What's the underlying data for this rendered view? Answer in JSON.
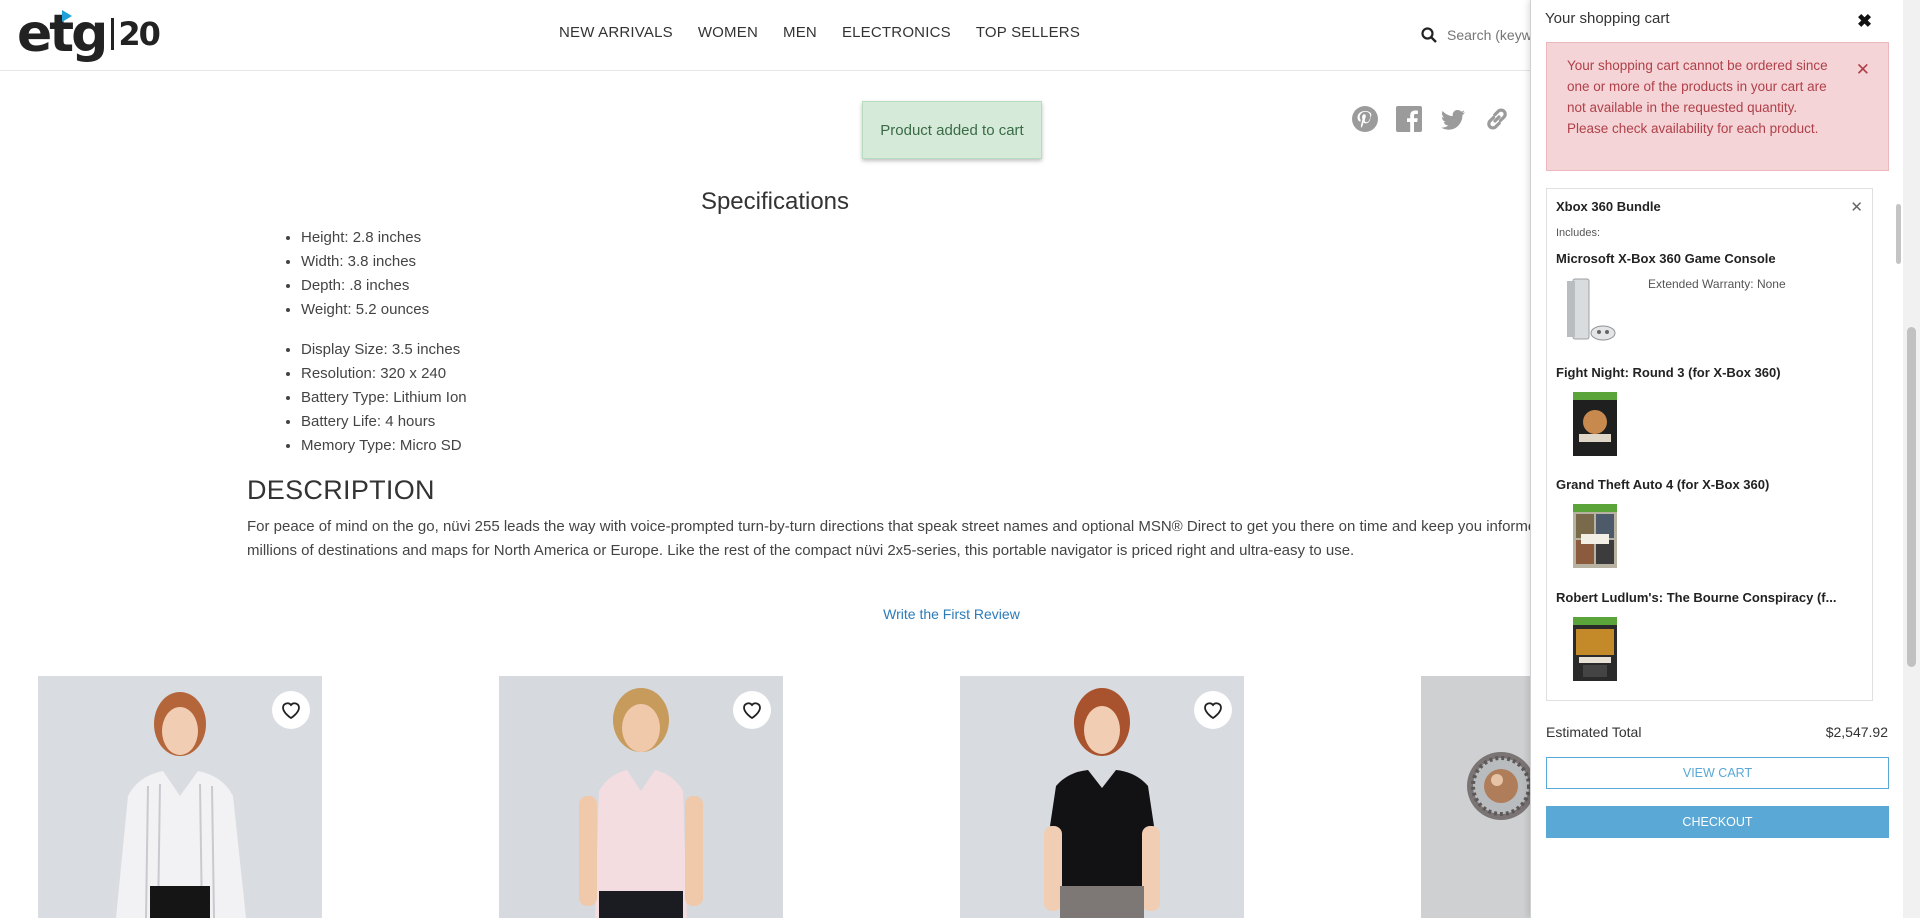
{
  "header": {
    "logo_main": "etg",
    "logo_badge": "20",
    "nav": [
      "NEW ARRIVALS",
      "WOMEN",
      "MEN",
      "ELECTRONICS",
      "TOP SELLERS"
    ],
    "search_placeholder": "Search (keywords, etc)"
  },
  "toast": "Product added to cart",
  "share_icons": [
    "pinterest-icon",
    "facebook-icon",
    "twitter-icon",
    "link-icon"
  ],
  "specs": {
    "title": "Specifications",
    "group_a": [
      "Height: 2.8 inches",
      "Width: 3.8 inches",
      "Depth: .8 inches",
      "Weight: 5.2 ounces"
    ],
    "group_b": [
      "Display Size: 3.5 inches",
      "Resolution: 320 x 240",
      "Battery Type: Lithium Ion",
      "Battery Life: 4 hours",
      "Memory Type: Micro SD"
    ]
  },
  "description": {
    "title": "DESCRIPTION",
    "line1": "For peace of mind on the go, nüvi 255 leads the way with voice-prompted turn-by-turn directions that speak street names and optional MSN® Direct to get you there on time and keep you informed",
    "line2": "millions of destinations and maps for North America or Europe. Like the rest of the compact nüvi 2x5-series, this portable navigator is priced right and ultra-easy to use."
  },
  "review_link": "Write the First Review",
  "cart": {
    "title": "Your shopping cart",
    "alert": "Your shopping cart cannot be ordered since one or more of the products in your cart are not available in the requested quantity. Please check availability for each product.",
    "bundle_name": "Xbox 360 Bundle",
    "includes_label": "Includes:",
    "items": [
      {
        "name": "Microsoft X-Box 360 Game Console",
        "warranty": "Extended Warranty: None"
      },
      {
        "name": "Fight Night: Round 3 (for X-Box 360)"
      },
      {
        "name": "Grand Theft Auto 4 (for X-Box 360)"
      },
      {
        "name": "Robert Ludlum's: The Bourne Conspiracy (f..."
      }
    ],
    "total_label": "Estimated Total",
    "total_value": "$2,547.92",
    "view_cart": "VIEW CART",
    "checkout": "CHECKOUT"
  }
}
